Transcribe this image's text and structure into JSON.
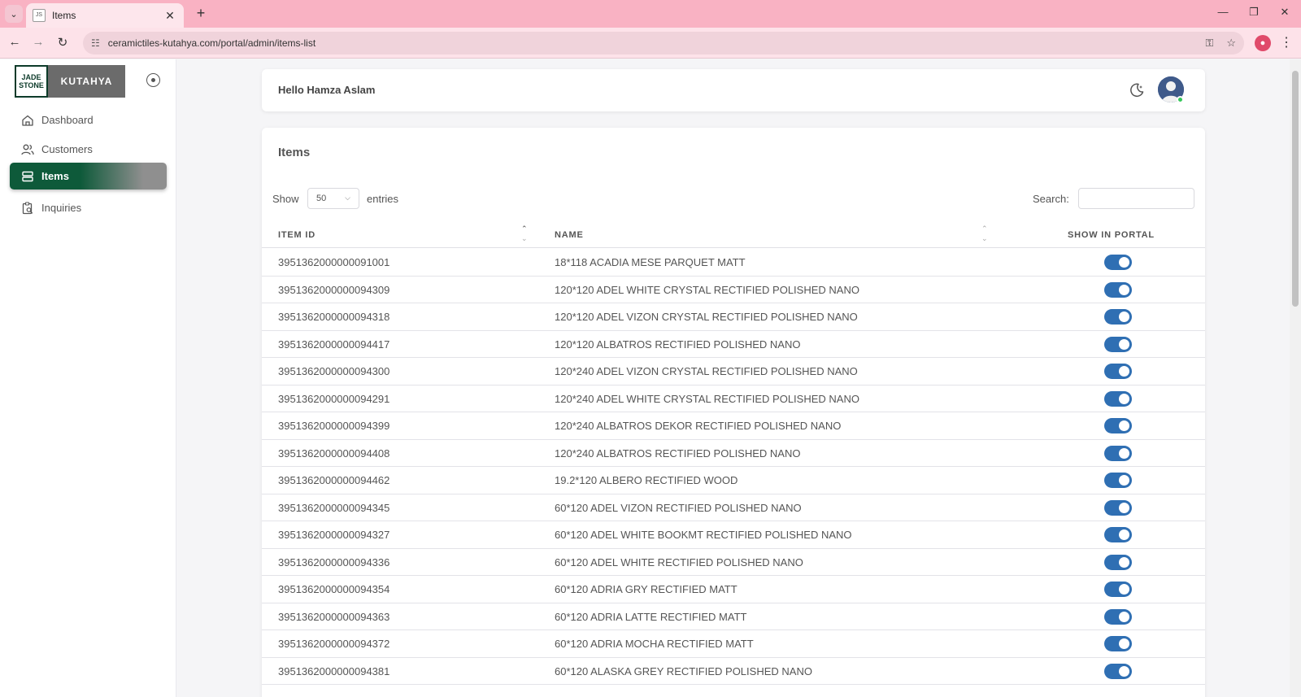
{
  "browser": {
    "tab_title": "Items",
    "url_site_icon": "tune-icon",
    "url": "ceramictiles-kutahya.com/portal/admin/items-list"
  },
  "sidebar": {
    "logo_jade_line1": "JADE",
    "logo_jade_line2": "STONE",
    "logo_kutahya": "KUTAHYA",
    "items": [
      {
        "label": "Dashboard",
        "icon": "home-icon",
        "active": false
      },
      {
        "label": "Customers",
        "icon": "users-icon",
        "active": false
      },
      {
        "label": "Items",
        "icon": "stack-icon",
        "active": true
      },
      {
        "label": "Inquiries",
        "icon": "clipboard-search-icon",
        "active": false
      }
    ]
  },
  "header": {
    "greeting": "Hello Hamza Aslam",
    "status_color": "#34c759"
  },
  "items_card": {
    "title": "Items",
    "show_label": "Show",
    "entries_value": "50",
    "entries_label": "entries",
    "search_label": "Search:",
    "search_value": ""
  },
  "table": {
    "columns": [
      "ITEM ID",
      "NAME",
      "SHOW IN PORTAL"
    ],
    "toggle_color": "#2f6fb3",
    "rows": [
      {
        "id": "3951362000000091001",
        "name": "18*118 ACADIA MESE PARQUET MATT",
        "show": true
      },
      {
        "id": "3951362000000094309",
        "name": "120*120 ADEL WHITE CRYSTAL RECTIFIED POLISHED NANO",
        "show": true
      },
      {
        "id": "3951362000000094318",
        "name": "120*120 ADEL VIZON CRYSTAL RECTIFIED POLISHED NANO",
        "show": true
      },
      {
        "id": "3951362000000094417",
        "name": "120*120 ALBATROS RECTIFIED POLISHED NANO",
        "show": true
      },
      {
        "id": "3951362000000094300",
        "name": "120*240 ADEL VIZON CRYSTAL RECTIFIED POLISHED NANO",
        "show": true
      },
      {
        "id": "3951362000000094291",
        "name": "120*240 ADEL WHITE CRYSTAL RECTIFIED POLISHED NANO",
        "show": true
      },
      {
        "id": "3951362000000094399",
        "name": "120*240 ALBATROS DEKOR RECTIFIED POLISHED NANO",
        "show": true
      },
      {
        "id": "3951362000000094408",
        "name": "120*240 ALBATROS RECTIFIED POLISHED NANO",
        "show": true
      },
      {
        "id": "3951362000000094462",
        "name": "19.2*120 ALBERO RECTIFIED WOOD",
        "show": true
      },
      {
        "id": "3951362000000094345",
        "name": "60*120 ADEL VIZON RECTIFIED POLISHED NANO",
        "show": true
      },
      {
        "id": "3951362000000094327",
        "name": "60*120 ADEL WHITE BOOKMT RECTIFIED POLISHED NANO",
        "show": true
      },
      {
        "id": "3951362000000094336",
        "name": "60*120 ADEL WHITE RECTIFIED POLISHED NANO",
        "show": true
      },
      {
        "id": "3951362000000094354",
        "name": "60*120 ADRIA GRY RECTIFIED MATT",
        "show": true
      },
      {
        "id": "3951362000000094363",
        "name": "60*120 ADRIA LATTE RECTIFIED MATT",
        "show": true
      },
      {
        "id": "3951362000000094372",
        "name": "60*120 ADRIA MOCHA RECTIFIED MATT",
        "show": true
      },
      {
        "id": "3951362000000094381",
        "name": "60*120 ALASKA GREY RECTIFIED POLISHED NANO",
        "show": true
      }
    ]
  }
}
